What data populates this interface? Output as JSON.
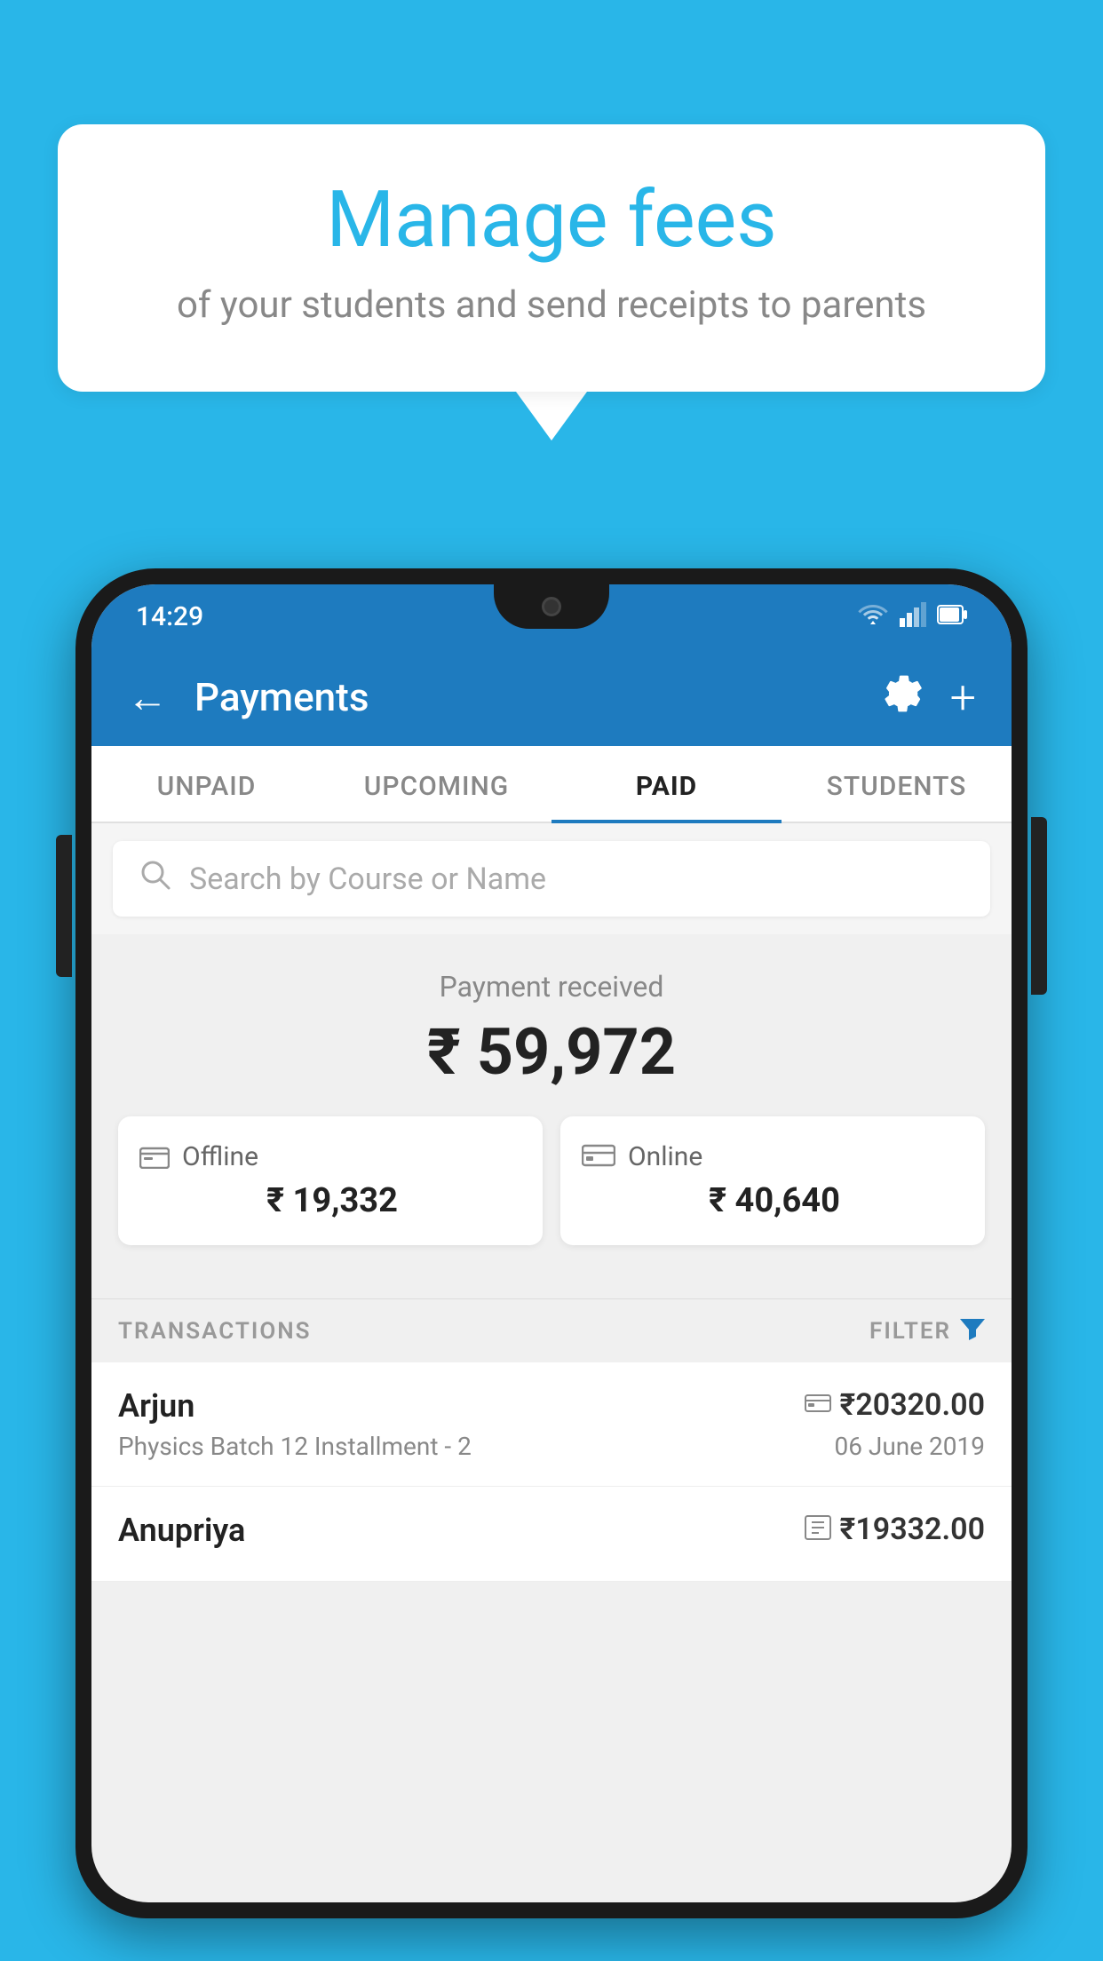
{
  "background_color": "#29b6e8",
  "speech_bubble": {
    "title": "Manage fees",
    "subtitle": "of your students and send receipts to parents"
  },
  "status_bar": {
    "time": "14:29",
    "wifi": "▼",
    "signal": "▲",
    "battery": "▮"
  },
  "app_bar": {
    "title": "Payments",
    "back_label": "←",
    "gear_label": "⚙",
    "plus_label": "+"
  },
  "tabs": [
    {
      "id": "unpaid",
      "label": "UNPAID",
      "active": false
    },
    {
      "id": "upcoming",
      "label": "UPCOMING",
      "active": false
    },
    {
      "id": "paid",
      "label": "PAID",
      "active": true
    },
    {
      "id": "students",
      "label": "STUDENTS",
      "active": false
    }
  ],
  "search": {
    "placeholder": "Search by Course or Name"
  },
  "payment_received": {
    "label": "Payment received",
    "amount": "₹ 59,972"
  },
  "payment_cards": [
    {
      "type": "Offline",
      "amount": "₹ 19,332",
      "icon": "💳"
    },
    {
      "type": "Online",
      "amount": "₹ 40,640",
      "icon": "💳"
    }
  ],
  "transactions_header": {
    "label": "TRANSACTIONS",
    "filter_label": "FILTER"
  },
  "transactions": [
    {
      "name": "Arjun",
      "course": "Physics Batch 12 Installment - 2",
      "amount": "₹20320.00",
      "date": "06 June 2019",
      "icon": "💳"
    },
    {
      "name": "Anupriya",
      "course": "",
      "amount": "₹19332.00",
      "date": "",
      "icon": "💵"
    }
  ]
}
